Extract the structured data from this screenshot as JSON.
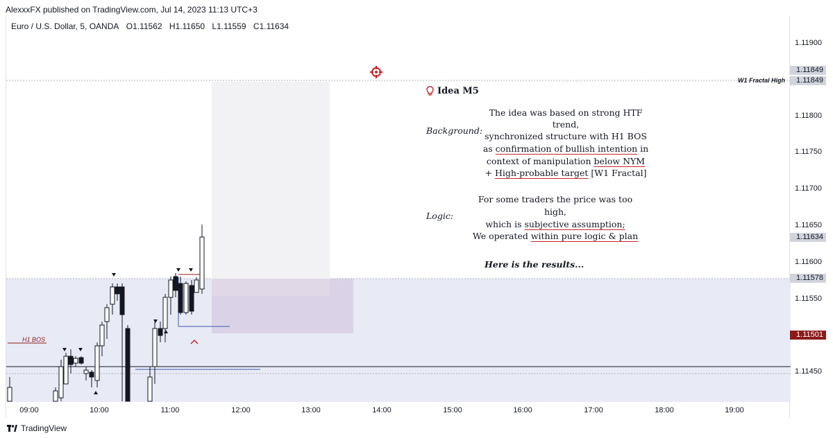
{
  "header": {
    "publisher_line": "AlexxxFX published on TradingView.com, Jul 14, 2023 11:13 UTC+3"
  },
  "symbol": {
    "name": "Euro / U.S. Dollar, 5, OANDA",
    "open": "O1.11562",
    "high": "H1.11650",
    "low": "L1.11559",
    "close": "C1.11634"
  },
  "price_axis": {
    "ticks": [
      "1.11900",
      "1.11800",
      "1.11750",
      "1.11700",
      "1.11650",
      "1.11600",
      "1.11550",
      "1.11450"
    ],
    "badges": {
      "target_top": "1.11849",
      "target_line": "1.11849",
      "current": "1.11634",
      "zone_top": "1.11578",
      "last": "1.11501"
    }
  },
  "time_axis": {
    "ticks": [
      "09:00",
      "10:00",
      "11:00",
      "12:00",
      "13:00",
      "14:00",
      "15:00",
      "16:00",
      "17:00",
      "18:00",
      "19:00"
    ]
  },
  "annotations": {
    "fractal_label": "W1 Fractal High",
    "bos_label": "H1 BOS",
    "idea_title": "Idea M5",
    "background_label": "Background:",
    "logic_label": "Logic:",
    "bg_line1": "The idea was based on strong HTF",
    "bg_line2": "trend,",
    "bg_line3": "synchronized structure with H1 BOS",
    "bg_line4a": "as ",
    "bg_line4b": "confirmation of bullish intention",
    "bg_line4c": " in",
    "bg_line5a": "context of manipulation ",
    "bg_line5b": "below NYM",
    "bg_line6a": "+ ",
    "bg_line6b": "High-probable target",
    "bg_line6c": " [W1 Fractal]",
    "logic_line1": "For some traders the price was too",
    "logic_line2": "high,",
    "logic_line3a": "which is ",
    "logic_line3b": "subjective assumption;",
    "logic_line4a": "We operated ",
    "logic_line4b": "within pure logic & plan",
    "results": "Here is the results..."
  },
  "footer": {
    "brand": "TradingView"
  },
  "colors": {
    "bull_body": "#ffffff",
    "bear_body": "#131722",
    "zone": "#e8eaf5",
    "accent_red": "#c9252b",
    "dark_red": "#8b1a1a",
    "blue_line": "#3d5bab"
  },
  "icons": {
    "target": "crosshair-target-icon",
    "idea": "lightbulb-icon",
    "logo": "tradingview-logo-icon"
  }
}
